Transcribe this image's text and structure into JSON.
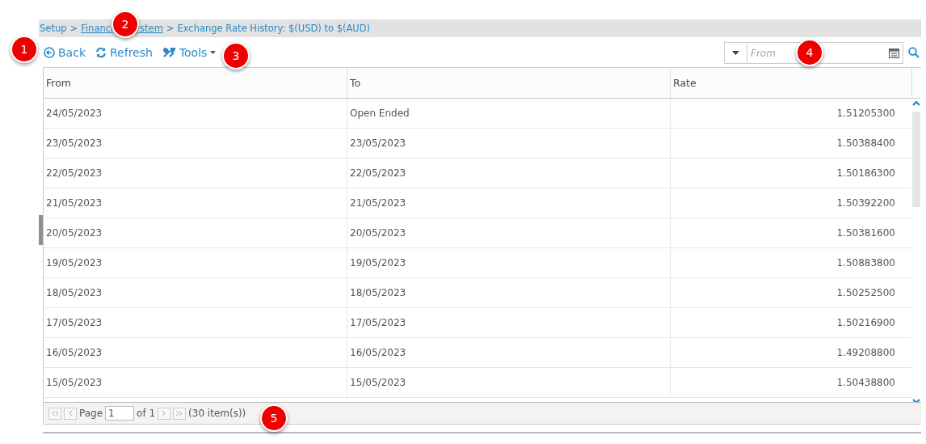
{
  "breadcrumb": [
    {
      "label": "Setup",
      "link": false
    },
    {
      "label_parts": [
        "Financi",
        "ystem"
      ],
      "link": true
    },
    {
      "label": "Exchange Rate History: $(USD) to $(AUD)",
      "link": false
    }
  ],
  "breadcrumb_separator": ">",
  "toolbar": [
    {
      "label": "Back",
      "kind": "back"
    },
    {
      "label": "Refresh",
      "kind": "refresh"
    },
    {
      "label": "Tools",
      "kind": "tools"
    }
  ],
  "filter": {
    "placeholder": "From"
  },
  "table": {
    "columns": [
      "From",
      "To",
      "Rate"
    ],
    "rows": [
      [
        "24/05/2023",
        "Open Ended",
        "1.51205300"
      ],
      [
        "23/05/2023",
        "23/05/2023",
        "1.50388400"
      ],
      [
        "22/05/2023",
        "22/05/2023",
        "1.50186300"
      ],
      [
        "21/05/2023",
        "21/05/2023",
        "1.50392200"
      ],
      [
        "20/05/2023",
        "20/05/2023",
        "1.50381600"
      ],
      [
        "19/05/2023",
        "19/05/2023",
        "1.50883800"
      ],
      [
        "18/05/2023",
        "18/05/2023",
        "1.50252500"
      ],
      [
        "17/05/2023",
        "17/05/2023",
        "1.50216900"
      ],
      [
        "16/05/2023",
        "16/05/2023",
        "1.49208800"
      ],
      [
        "15/05/2023",
        "15/05/2023",
        "1.50438800"
      ]
    ]
  },
  "pager": {
    "page_label": "Page",
    "page": "1",
    "of": "of 1",
    "items": "(30 item(s))"
  },
  "callouts": [
    "1",
    "2",
    "3",
    "4",
    "5"
  ]
}
